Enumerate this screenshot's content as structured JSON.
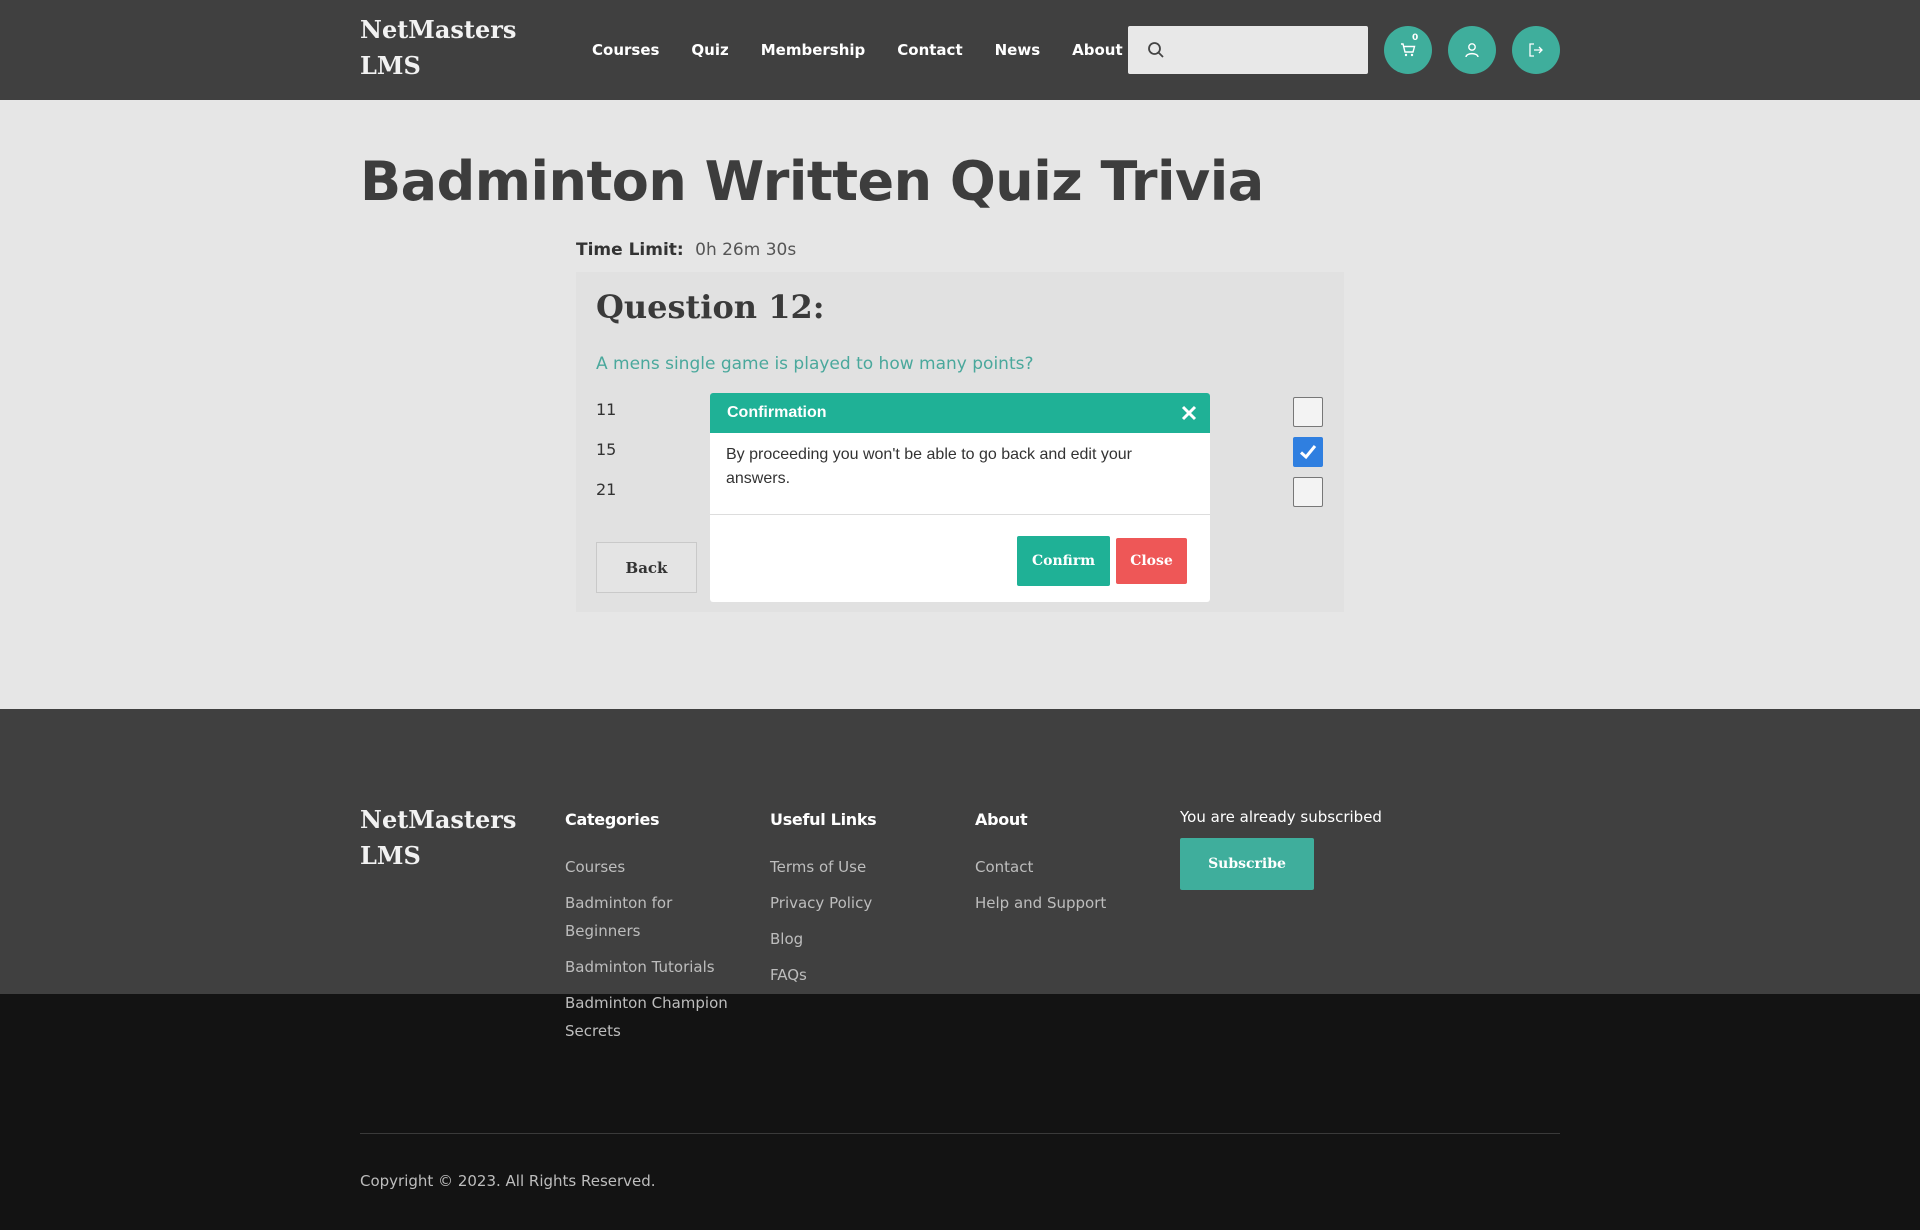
{
  "header": {
    "logo": "NetMasters LMS",
    "nav": [
      "Courses",
      "Quiz",
      "Membership",
      "Contact",
      "News",
      "About"
    ],
    "search": {
      "placeholder": ""
    },
    "cart_count": "0",
    "icons": [
      "search-icon",
      "cart-icon",
      "user-icon",
      "logout-icon",
      "chevron-down-icon"
    ]
  },
  "main": {
    "title": "Badminton Written Quiz Trivia",
    "time_limit_label": "Time Limit:",
    "time_limit_value": "0h 26m 30s",
    "question_title": "Question 12:",
    "question_text": "A mens single game is played to how many points?",
    "options": [
      {
        "label": "11",
        "checked": false
      },
      {
        "label": "15",
        "checked": true
      },
      {
        "label": "21",
        "checked": false
      }
    ],
    "back_label": "Back"
  },
  "modal": {
    "title": "Confirmation",
    "body": "By proceeding you won't be able to go back and edit your answers.",
    "confirm_label": "Confirm",
    "close_label": "Close"
  },
  "footer": {
    "logo": "NetMasters LMS",
    "categories": {
      "title": "Categories",
      "links": [
        "Courses",
        "Badminton for Beginners",
        "Badminton Tutorials",
        "Badminton Champion Secrets"
      ]
    },
    "useful_links": {
      "title": "Useful Links",
      "links": [
        "Terms of Use",
        "Privacy Policy",
        "Blog",
        "FAQs"
      ]
    },
    "about": {
      "title": "About",
      "links": [
        "Contact",
        "Help and Support"
      ]
    },
    "subscribe_text": "You are already subscribed",
    "subscribe_label": "Subscribe",
    "copyright": "Copyright © 2023. All Rights Reserved."
  },
  "colors": {
    "accent": "#3fae9c",
    "modal_accent": "#1fb196",
    "danger": "#ee5757",
    "checkbox": "#2f7fe0",
    "header_bg": "#404040"
  }
}
